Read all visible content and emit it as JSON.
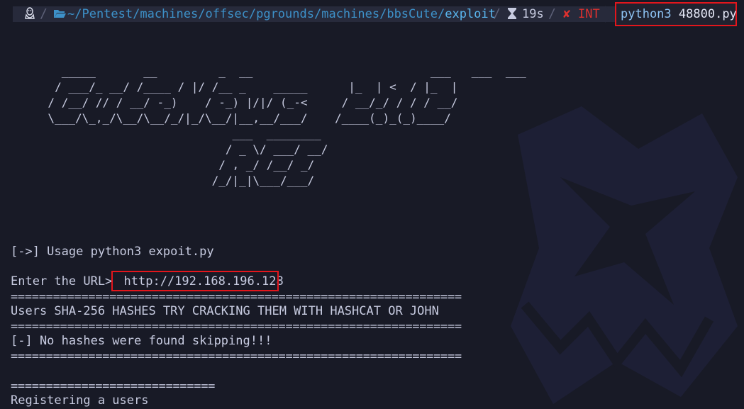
{
  "prompt": {
    "os_icon": "linux-tux-icon",
    "folder_icon": "folder-open-icon",
    "path_dirs": "~/Pentest/machines/offsec/pgrounds/machines/bbsCute/",
    "path_last": "exploit",
    "duration_icon": "hourglass-icon",
    "duration": "19s",
    "status_icon": "cross-icon",
    "status": "INT",
    "command": "python3",
    "command_arg": "48800.py"
  },
  "banner_art": "         _____       __         _  __                          ___   ___  ___ \n        / ___/_ __/ /____ / |/ /__ _    _____      |_  | <  / |_  |\n       / /__/ // / __/ -_)    / -_) |/|/ (_-<     / __/_/ / / / __/ \n       \\___/\\_,_/\\__/\\__/_/|_/\\__/|__,__/___/    /____(_)_(_)____/  \n                                  ___  ________\n                                 / _ \\/ ___/ __/\n                                / , _/ /__/ _/  \n                               /_/|_|\\___/___/  ",
  "terminal": {
    "usage": "[->] Usage python3 expoit.py",
    "url_prompt": "Enter the URL> ",
    "url_value": "http://192.168.196.128",
    "rule": "================================================================",
    "hashes_msg": "Users SHA-256 HASHES TRY CRACKING THEM WITH HASHCAT OR JOHN",
    "no_hashes": "[-] No hashes were found skipping!!!",
    "short_rule": "=============================",
    "registering": "Registering a users"
  },
  "colors": {
    "background": "#181a26",
    "highlight_border": "#e3161c",
    "path": "#3d91c9",
    "error": "#e0312f"
  }
}
